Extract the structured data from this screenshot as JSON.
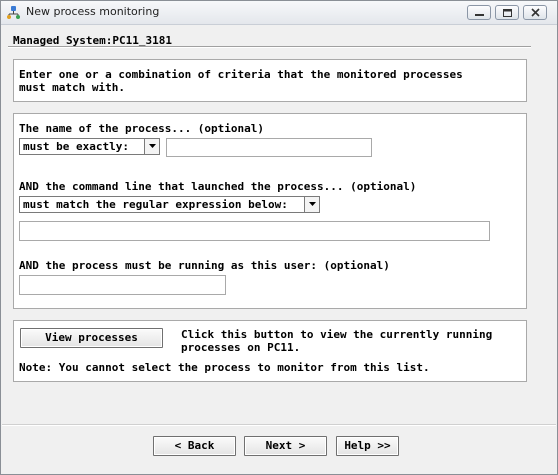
{
  "window": {
    "title": "New process monitoring"
  },
  "header": {
    "managed_system": "Managed System:PC11_3181"
  },
  "instructions": {
    "text": "Enter one or a combination of criteria that the monitored processes\nmust match with."
  },
  "criteria": {
    "process_name_label": "The name of the process... (optional)",
    "process_name_match": "must be exactly:",
    "process_name_value": "",
    "command_line_label": "AND the command line that launched the process... (optional)",
    "command_line_match": "must match the regular expression below:",
    "command_line_value": "",
    "user_label": "AND the process must be running as this user: (optional)",
    "user_value": ""
  },
  "view": {
    "button_label": "View processes",
    "description": "Click this button to view the currently running\nprocesses on PC11.",
    "note": "Note: You cannot select the process to monitor from this list."
  },
  "footer": {
    "back_label": "< Back",
    "next_label": "Next >",
    "help_label": "Help >>"
  },
  "icons": {
    "app": "process-monitor-icon",
    "minimize": "minimize-icon",
    "maximize": "maximize-icon",
    "close": "close-icon",
    "dropdown": "chevron-down-icon"
  }
}
